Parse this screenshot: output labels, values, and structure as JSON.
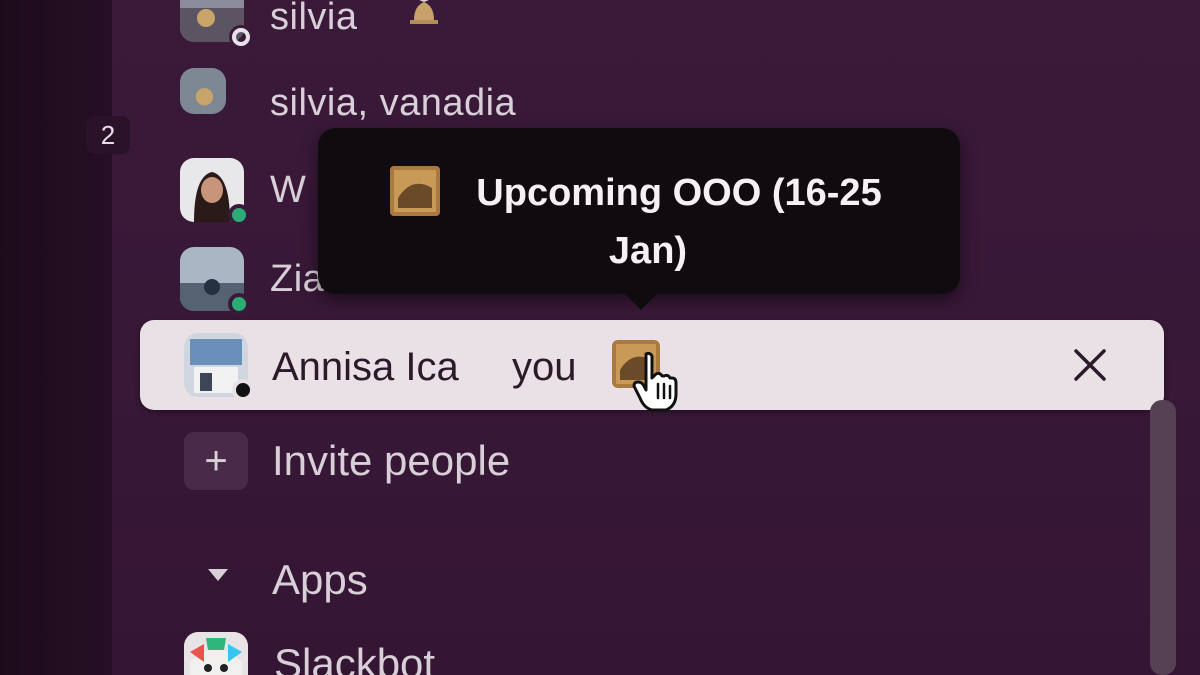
{
  "sidebar": {
    "dms": [
      {
        "label": "silvia",
        "status": "away",
        "has_hourglass": true
      },
      {
        "label": "silvia, vanadia",
        "group_count": "2"
      },
      {
        "label": "W",
        "status": "online"
      },
      {
        "label": "Zia",
        "status": "online"
      }
    ],
    "active_dm": {
      "name": "Annisa Ica",
      "you_label": "you",
      "status": "dnd"
    },
    "invite": {
      "label": "Invite people",
      "icon": "plus-icon"
    },
    "apps_section": {
      "label": "Apps",
      "icon": "caret-down-icon"
    },
    "apps": [
      {
        "label": "Slackbot"
      }
    ]
  },
  "tooltip": {
    "text": "Upcoming OOO (16-25 Jan)"
  },
  "colors": {
    "sidebar_bg": "#3a1939",
    "active_row_bg": "#e9e1e6",
    "online": "#2bac76",
    "tooltip_bg": "#0f0b0f"
  }
}
